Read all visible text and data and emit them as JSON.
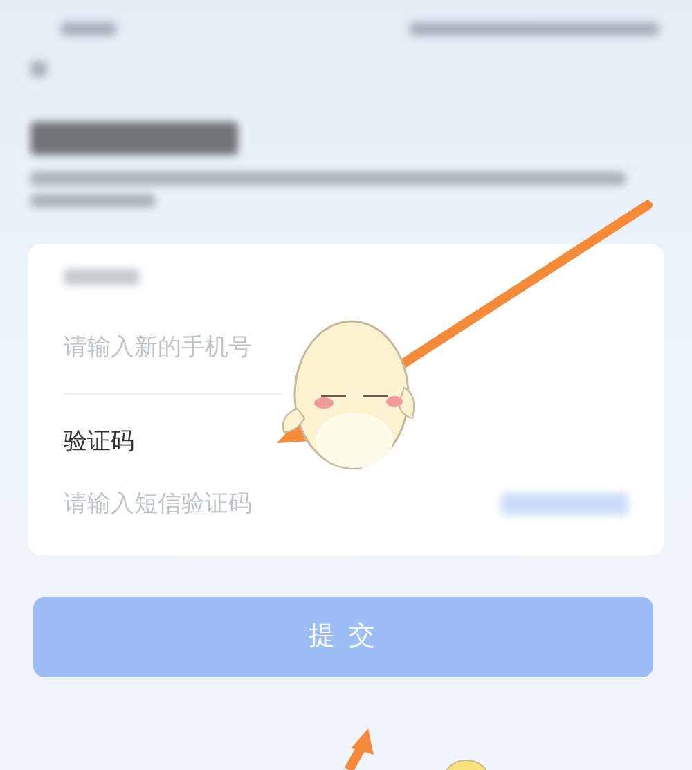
{
  "form": {
    "new_phone": {
      "placeholder": "请输入新的手机号"
    },
    "code": {
      "label": "验证码",
      "placeholder": "请输入短信验证码"
    }
  },
  "submit_button": {
    "label": "提 交",
    "disabled": true
  }
}
